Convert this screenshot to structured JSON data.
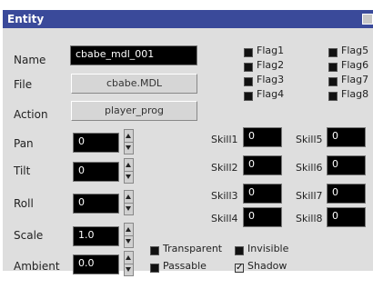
{
  "window": {
    "title": "Entity"
  },
  "labels": {
    "name": "Name",
    "file": "File",
    "action": "Action",
    "pan": "Pan",
    "tilt": "Tilt",
    "roll": "Roll",
    "scale": "Scale",
    "ambient": "Ambient"
  },
  "fields": {
    "name": "cbabe_mdl_001",
    "file": "cbabe.MDL",
    "action": "player_prog",
    "pan": "0",
    "tilt": "0",
    "roll": "0",
    "scale": "1.0",
    "ambient": "0.0"
  },
  "flags": [
    {
      "label": "Flag1",
      "checked": false
    },
    {
      "label": "Flag2",
      "checked": false
    },
    {
      "label": "Flag3",
      "checked": false
    },
    {
      "label": "Flag4",
      "checked": false
    },
    {
      "label": "Flag5",
      "checked": false
    },
    {
      "label": "Flag6",
      "checked": false
    },
    {
      "label": "Flag7",
      "checked": false
    },
    {
      "label": "Flag8",
      "checked": false
    }
  ],
  "skills": [
    {
      "label": "Skill1",
      "value": "0"
    },
    {
      "label": "Skill2",
      "value": "0"
    },
    {
      "label": "Skill3",
      "value": "0"
    },
    {
      "label": "Skill4",
      "value": "0"
    },
    {
      "label": "Skill5",
      "value": "0"
    },
    {
      "label": "Skill6",
      "value": "0"
    },
    {
      "label": "Skill7",
      "value": "0"
    },
    {
      "label": "Skill8",
      "value": "0"
    }
  ],
  "options": {
    "transparent": {
      "label": "Transparent",
      "checked": false
    },
    "invisible": {
      "label": "Invisible",
      "checked": false
    },
    "passable": {
      "label": "Passable",
      "checked": false
    },
    "shadow": {
      "label": "Shadow",
      "checked": true
    }
  }
}
